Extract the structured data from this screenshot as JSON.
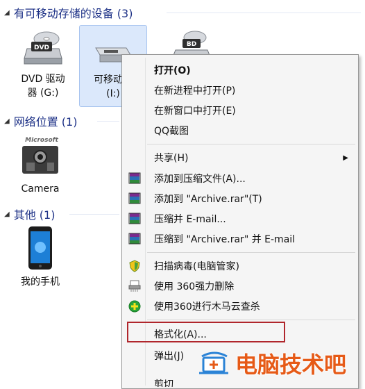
{
  "groups": {
    "removable": {
      "title": "有可移动存储的设备 (3)"
    },
    "network": {
      "title": "网络位置 (1)"
    },
    "other": {
      "title": "其他 (1)"
    }
  },
  "devices": {
    "dvd": {
      "line1": "DVD 驱动",
      "line2": "器 (G:)",
      "badge": "DVD"
    },
    "removable": {
      "line1": "可移动磁",
      "line2": "(I:)"
    },
    "bd": {
      "badge": "BD"
    },
    "camera": {
      "line1": "Camera",
      "logo": "Microsoft"
    },
    "phone": {
      "line1": "我的手机"
    }
  },
  "menu": {
    "items": [
      {
        "label": "打开(O)"
      },
      {
        "label": "在新进程中打开(P)"
      },
      {
        "label": "在新窗口中打开(E)"
      },
      {
        "label": "QQ截图"
      },
      {
        "label": "共享(H)"
      },
      {
        "label": "添加到压缩文件(A)..."
      },
      {
        "label": "添加到 \"Archive.rar\"(T)"
      },
      {
        "label": "压缩并 E-mail..."
      },
      {
        "label": "压缩到 \"Archive.rar\" 并 E-mail"
      },
      {
        "label": "扫描病毒(电脑管家)"
      },
      {
        "label": "使用 360强力删除"
      },
      {
        "label": "使用360进行木马云查杀"
      },
      {
        "label": "格式化(A)..."
      },
      {
        "label": "弹出(J)"
      },
      {
        "label": "剪切"
      }
    ]
  },
  "watermark": {
    "text": "电脑技术吧"
  },
  "colors": {
    "highlight_border": "#b0262c",
    "watermark": "#e65a17",
    "group_title": "#1e3287"
  }
}
